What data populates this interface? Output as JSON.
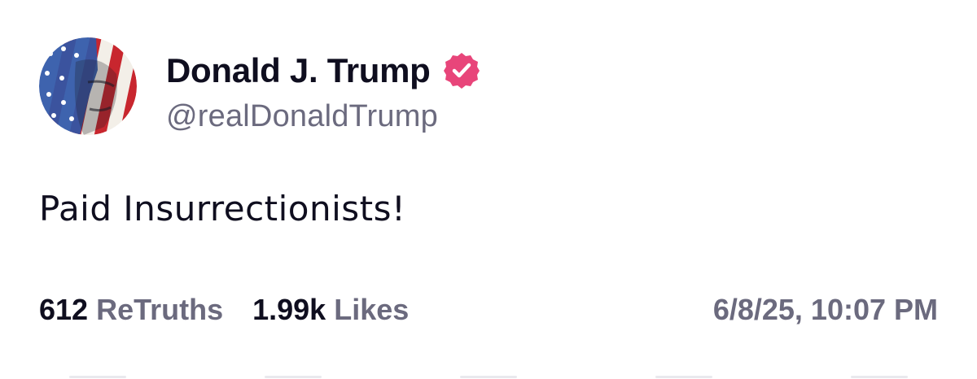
{
  "author": {
    "display_name": "Donald J. Trump",
    "handle": "@realDonaldTrump",
    "verified": true,
    "verified_badge_color": "#e8457a",
    "avatar_icon": "flag-portrait-avatar"
  },
  "post": {
    "text": "Paid Insurrectionists!"
  },
  "stats": {
    "retruths_count": "612",
    "retruths_label": "ReTruths",
    "likes_count": "1.99k",
    "likes_label": "Likes"
  },
  "timestamp": "6/8/25, 10:07 PM",
  "colors": {
    "text_primary": "#0f0e1f",
    "text_secondary": "#6b6a7e",
    "background": "#ffffff"
  }
}
